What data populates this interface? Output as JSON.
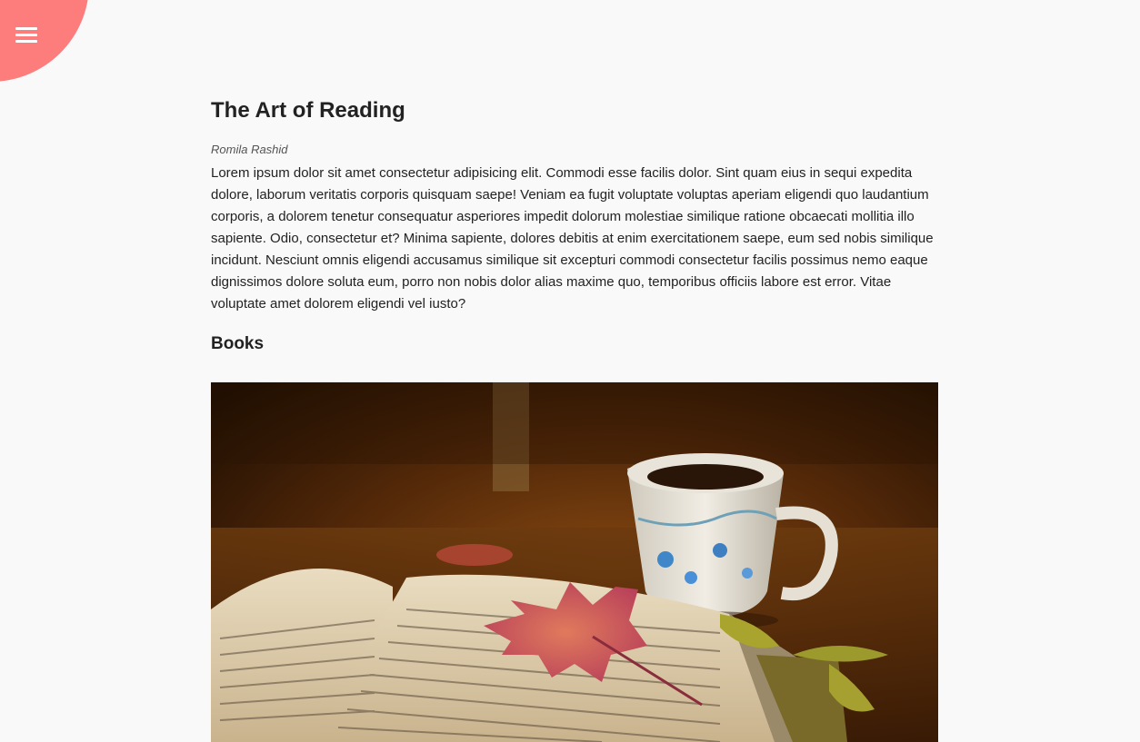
{
  "menu": {
    "icon": "hamburger-menu-icon",
    "accent": "#fd7c7c"
  },
  "article": {
    "title": "The Art of Reading",
    "author": "Romila Rashid",
    "body": "Lorem ipsum dolor sit amet consectetur adipisicing elit. Commodi esse facilis dolor. Sint quam eius in sequi expedita dolore, laborum veritatis corporis quisquam saepe! Veniam ea fugit voluptate voluptas aperiam eligendi quo laudantium corporis, a dolorem tenetur consequatur asperiores impedit dolorum molestiae similique ratione obcaecati mollitia illo sapiente. Odio, consectetur et? Minima sapiente, dolores debitis at enim exercitationem saepe, eum sed nobis similique incidunt. Nesciunt omnis eligendi accusamus similique sit excepturi commodi consectetur facilis possimus nemo eaque dignissimos dolore soluta eum, porro non nobis dolor alias maxime quo, temporibus officiis labore est error. Vitae voluptate amet dolorem eligendi vel iusto?",
    "section_heading": "Books"
  },
  "colors": {
    "background": "#f9f9f9",
    "text": "#222222",
    "accent": "#fd7c7c"
  }
}
